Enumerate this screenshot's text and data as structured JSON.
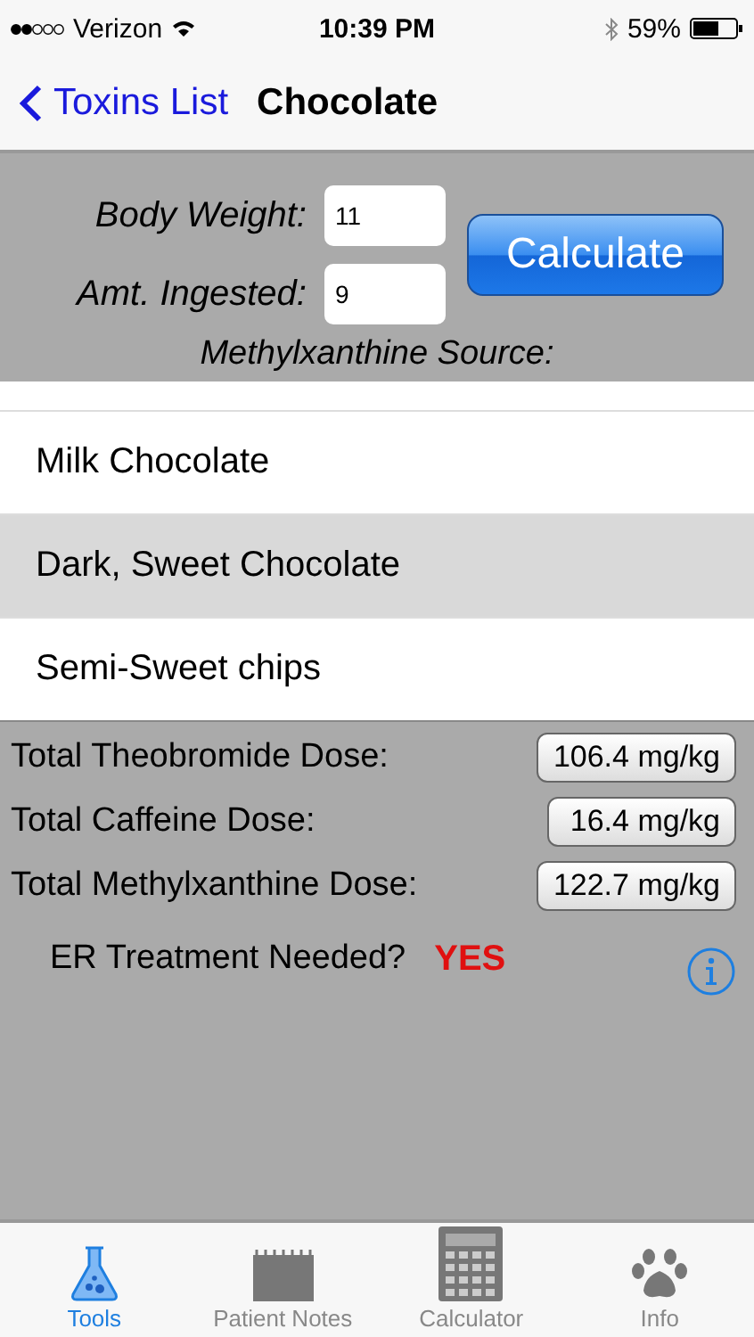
{
  "status_bar": {
    "carrier": "Verizon",
    "time": "10:39 PM",
    "battery": "59%"
  },
  "nav": {
    "back": "Toxins List",
    "title": "Chocolate"
  },
  "form": {
    "fields": [
      {
        "label": "Body Weight:",
        "value": "11"
      },
      {
        "label": "Amt. Ingested:",
        "value": "9"
      }
    ],
    "button": "Calculate",
    "source_label": "Methylxanthine Source:"
  },
  "sources": [
    {
      "label": "Milk Chocolate",
      "selected": false
    },
    {
      "label": "Dark, Sweet Chocolate",
      "selected": true
    },
    {
      "label": "Semi-Sweet chips",
      "selected": false
    }
  ],
  "results": [
    {
      "label": "Total Theobromide Dose:",
      "value": "106.4 mg/kg"
    },
    {
      "label": "Total Caffeine Dose:",
      "value": "16.4 mg/kg"
    },
    {
      "label": "Total Methylxanthine Dose:",
      "value": "122.7 mg/kg"
    }
  ],
  "er": {
    "label": "ER Treatment Needed?",
    "value": "YES"
  },
  "tabs": [
    {
      "label": "Tools",
      "kind": "flask",
      "selected": true
    },
    {
      "label": "Patient Notes",
      "kind": "notes",
      "selected": false
    },
    {
      "label": "Calculator",
      "kind": "calculator",
      "selected": false
    },
    {
      "label": "Info",
      "kind": "paw",
      "selected": false
    }
  ]
}
